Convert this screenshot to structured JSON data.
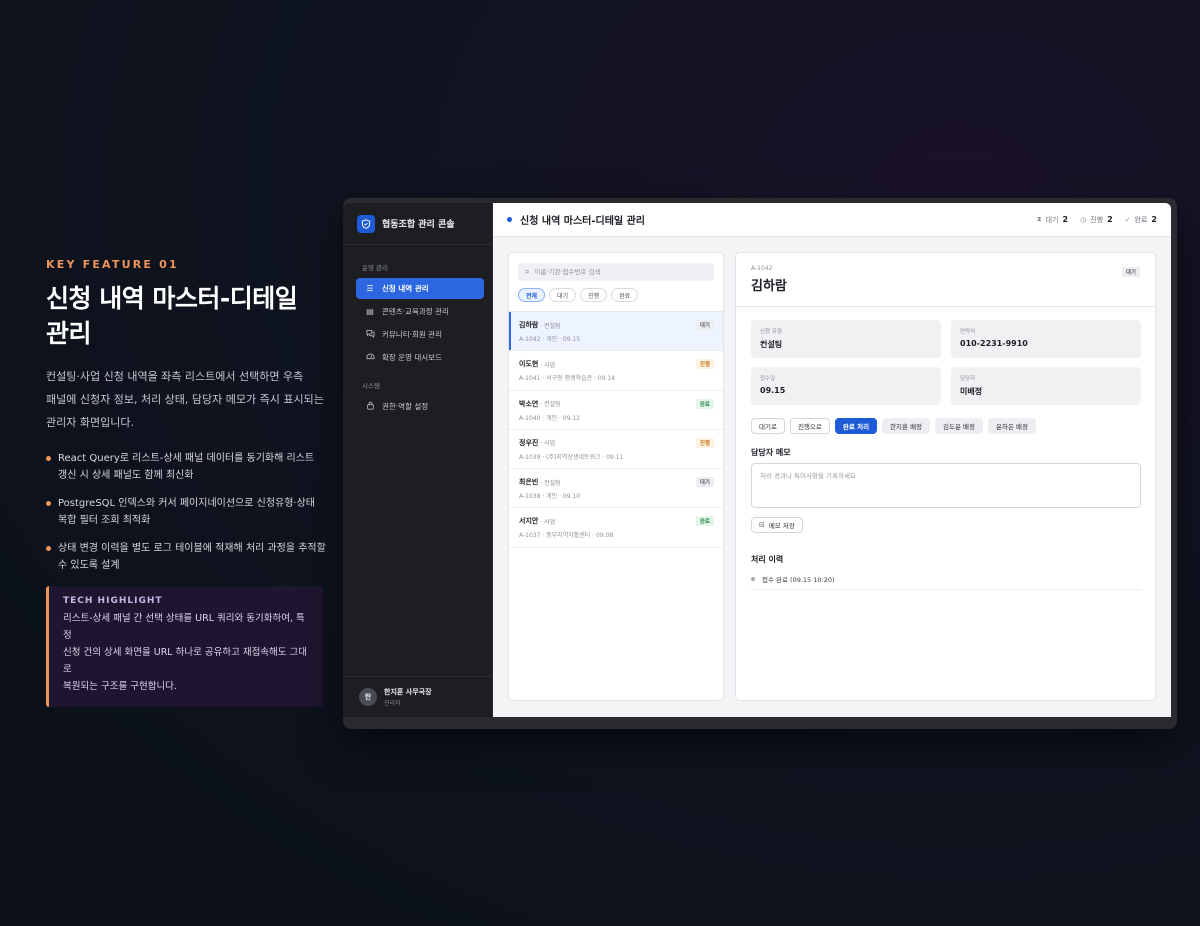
{
  "promo": {
    "kicker": "KEY FEATURE 01",
    "headline_line1": "신청 내역 마스터-디테일",
    "headline_line2": "관리",
    "lead_line1": "컨설팅·사업 신청 내역을 좌측 리스트에서 선택하면 우측",
    "lead_line2": "패널에 신청자 정보, 처리 상태, 담당자 메모가 즉시 표시되는",
    "lead_line3": "관리자 화면입니다.",
    "bullets": [
      {
        "line1": "React Query로 리스트-상세 패널 데이터를 동기화해 리스트",
        "line2": "갱신 시 상세 패널도 함께 최신화"
      },
      {
        "line1": "PostgreSQL 인덱스와 커서 페이지네이션으로 신청유형·상태",
        "line2": "복합 필터 조회 최적화"
      },
      {
        "line1": "상태 변경 이력을 별도 로그 테이블에 적재해 처리 과정을 추적할",
        "line2": "수 있도록 설계"
      }
    ],
    "tech_title": "TECH HIGHLIGHT",
    "tech_line1": "리스트-상세 패널 간 선택 상태를 URL 쿼리와 동기화하여, 특정",
    "tech_line2": "신청 건의 상세 화면을 URL 하나로 공유하고 재접속해도 그대로",
    "tech_line3": "복원되는 구조를 구현합니다.",
    "accent_color": "#f0955a"
  },
  "app": {
    "brand": "협동조합 관리 콘솔",
    "brand_color": "#1f5bd6",
    "sidebar": {
      "section_ops": "운영 관리",
      "section_sys": "시스템",
      "items": [
        {
          "label": "신청 내역 관리",
          "icon": "list-icon",
          "active": true
        },
        {
          "label": "콘텐츠·교육과정 관리",
          "icon": "stack-icon",
          "active": false
        },
        {
          "label": "커뮤니티·회원 관리",
          "icon": "chat-icon",
          "active": false
        },
        {
          "label": "확장 운영 대시보드",
          "icon": "gauge-icon",
          "active": false
        },
        {
          "label": "권한·역할 설정",
          "icon": "lock-icon",
          "active": false
        }
      ]
    },
    "profile": {
      "avatar": "한",
      "name": "한지훈 사무국장",
      "role": "관리자"
    },
    "topbar": {
      "title": "신청 내역 마스터-디테일 관리",
      "stats": [
        {
          "icon": "hourglass-icon",
          "label": "대기",
          "value": "2"
        },
        {
          "icon": "clock-icon",
          "label": "진행",
          "value": "2"
        },
        {
          "icon": "check-circle-icon",
          "label": "완료",
          "value": "2"
        }
      ]
    },
    "list": {
      "search_placeholder": "이름·기관·접수번호 검색",
      "filters": [
        "전체",
        "대기",
        "진행",
        "완료"
      ],
      "active_filter": "전체",
      "rows": [
        {
          "name": "김하람",
          "type": "· 컨설팅",
          "meta": "A-1042 · 개인 · 09.15",
          "status": "대기",
          "status_kind": "wait",
          "selected": true
        },
        {
          "name": "이도현",
          "type": "· 사업",
          "meta": "A-1041 · 서구청 평생학습관 · 09.14",
          "status": "진행",
          "status_kind": "prog",
          "selected": false
        },
        {
          "name": "박소연",
          "type": "· 컨설팅",
          "meta": "A-1040 · 개인 · 09.12",
          "status": "완료",
          "status_kind": "done",
          "selected": false
        },
        {
          "name": "정우진",
          "type": "· 사업",
          "meta": "A-1039 · (주)지역상생네트워크 · 09.11",
          "status": "진행",
          "status_kind": "prog",
          "selected": false
        },
        {
          "name": "최은빈",
          "type": "· 컨설팅",
          "meta": "A-1038 · 개인 · 09.10",
          "status": "대기",
          "status_kind": "wait",
          "selected": false
        },
        {
          "name": "서지안",
          "type": "· 사업",
          "meta": "A-1037 · 중부지역자활센터 · 09.08",
          "status": "완료",
          "status_kind": "done",
          "selected": false
        }
      ]
    },
    "detail": {
      "id": "A-1042",
      "name": "김하람",
      "status": "대기",
      "fields": [
        {
          "label": "신청 유형",
          "value": "컨설팅"
        },
        {
          "label": "연락처",
          "value": "010-2231-9910"
        },
        {
          "label": "접수일",
          "value": "09.15"
        },
        {
          "label": "담당자",
          "value": "미배정"
        }
      ],
      "actions": [
        {
          "label": "대기로",
          "style": "outline"
        },
        {
          "label": "진행으로",
          "style": "outline"
        },
        {
          "label": "완료 처리",
          "style": "primary"
        },
        {
          "label": "한지훈 배정",
          "style": "ghost"
        },
        {
          "label": "김도윤 배정",
          "style": "ghost"
        },
        {
          "label": "윤하은 배정",
          "style": "ghost"
        }
      ],
      "memo_title": "담당자 메모",
      "memo_placeholder": "처리 경과나 특이사항을 기록하세요",
      "memo_save": "메모 저장",
      "history_title": "처리 이력",
      "history": [
        "접수 완료 (09.15 10:20)"
      ]
    }
  }
}
